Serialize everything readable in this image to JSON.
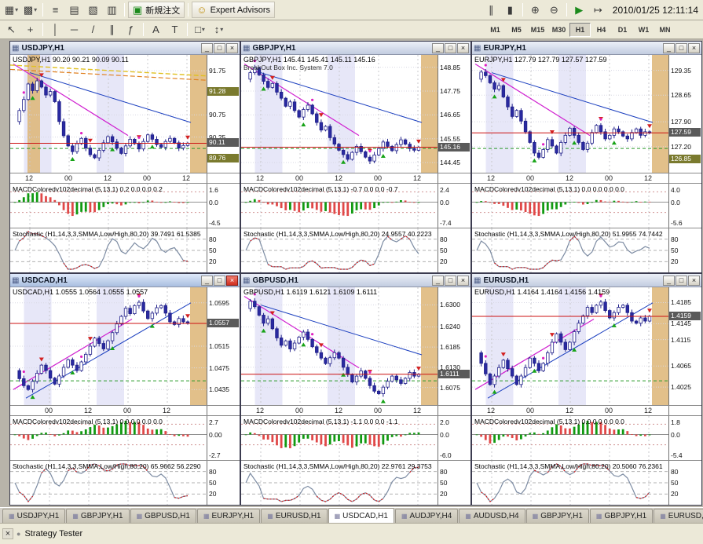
{
  "header": {
    "time": "2010/01/25 12:11:14",
    "new_order_label": "新規注文",
    "expert_advisors_label": "Expert Advisors"
  },
  "icons": {
    "dropdown": "▾",
    "new_chart": "▦",
    "profiles": "▩",
    "market_watch": "≡",
    "data_window": "▤",
    "navigator": "▧",
    "terminal": "▥",
    "new_order": "▣",
    "expert_advisors": "☺",
    "bar_chart": "∥",
    "candlestick": "▮",
    "line_chart": "~",
    "zoom_in": "⊕",
    "zoom_out": "⊖",
    "auto_scroll": "▶",
    "chart_shift": "↦",
    "cursor": "↖",
    "crosshair": "+",
    "vline": "│",
    "hline": "─",
    "trendline": "/",
    "channel": "∥",
    "fibonacci": "ƒ",
    "text": "A",
    "text_label": "T",
    "shapes": "□",
    "arrows": "↕",
    "tab_chart": "▦",
    "win_min": "_",
    "win_restore": "□",
    "win_close": "×",
    "close": "×",
    "bullet": "●"
  },
  "toolbar": {
    "timeframes": [
      "M1",
      "M5",
      "M15",
      "M30",
      "H1",
      "H4",
      "D1",
      "W1",
      "MN"
    ],
    "active_timeframe": "H1"
  },
  "colors": {
    "badge_current": "#5a5a5a",
    "badge_level": "#7a7a2e",
    "bull": "#ffffff",
    "bear": "#2a2aa0",
    "macd_up": "#119a11",
    "macd_down": "#e04848"
  },
  "charts": [
    {
      "title": "USDJPY,H1",
      "info": "USDJPY,H1 90.20 90.21 90.09 90.11",
      "info2": "",
      "active": false,
      "price_min": 89.55,
      "price_max": 92.0,
      "ticks": [
        "91.75",
        "90.75",
        "90.25"
      ],
      "badges": [
        {
          "label": "91.28",
          "color": "#7a7a2e"
        },
        {
          "label": "90.11",
          "color": "#5a5a5a"
        },
        {
          "label": "89.76",
          "color": "#7a7a2e"
        }
      ],
      "x_labels": [
        "12",
        "00",
        "12",
        "00",
        "12"
      ],
      "macd_label": "MACDColoredv102decimal (5,13,1) 0.2 0.0 0.0 0.2",
      "macd_ticks": [
        "1.6",
        "0.0",
        "-4.5"
      ],
      "stoch_label": "Stochastic (H1,14,3,3,SMMA,Low/High,80,20) 39.7491 61.5385",
      "stoch_ticks": [
        "80",
        "50",
        "20"
      ],
      "closes": [
        90.6,
        90.85,
        91.1,
        91.45,
        91.3,
        91.52,
        91.38,
        91.2,
        91.28,
        91.05,
        90.6,
        90.28,
        90.05,
        89.92,
        90.1,
        90.22,
        90.0,
        89.85,
        89.78,
        89.95,
        90.12,
        90.26,
        90.14,
        90.0,
        89.88,
        90.05,
        90.2,
        90.1,
        89.98,
        90.15,
        90.3,
        90.2,
        90.08,
        90.02,
        90.15,
        90.22,
        90.12,
        90.0,
        90.06,
        90.11
      ]
    },
    {
      "title": "GBPJPY,H1",
      "info": "GBPJPY,H1 145.41 145.41 145.11 145.16",
      "info2": "BreakOut Box Inc. System 7.0",
      "active": false,
      "price_min": 144.2,
      "price_max": 149.2,
      "ticks": [
        "148.85",
        "147.75",
        "146.65",
        "145.55",
        "144.45"
      ],
      "badges": [
        {
          "label": "145.16",
          "color": "#5a5a5a"
        }
      ],
      "x_labels": [
        "12",
        "00",
        "12",
        "00",
        "12"
      ],
      "macd_label": "MACDColoredv102decimal (5,13,1) -0.7 0.0 0.0 -0.7",
      "macd_ticks": [
        "2.4",
        "0.0",
        "-7.4"
      ],
      "stoch_label": "Stochastic (H1,14,3,3,SMMA,Low/High,80,20) 24.9557 40.2223",
      "stoch_ticks": [
        "80",
        "50",
        "20"
      ],
      "closes": [
        148.3,
        148.6,
        148.82,
        148.5,
        148.2,
        147.92,
        148.1,
        147.7,
        147.42,
        147.05,
        147.25,
        146.85,
        146.55,
        146.9,
        147.1,
        146.7,
        146.3,
        145.95,
        146.12,
        145.6,
        145.3,
        145.02,
        144.82,
        144.6,
        144.92,
        145.2,
        144.95,
        144.7,
        144.52,
        144.8,
        145.1,
        145.4,
        145.2,
        145.0,
        145.28,
        145.5,
        145.3,
        145.1,
        145.02,
        145.16
      ]
    },
    {
      "title": "EURJPY,H1",
      "info": "EURJPY,H1 127.79 127.79 127.57 127.59",
      "info2": "",
      "active": false,
      "price_min": 126.6,
      "price_max": 129.65,
      "ticks": [
        "129.35",
        "128.65",
        "127.90",
        "127.20"
      ],
      "badges": [
        {
          "label": "127.59",
          "color": "#5a5a5a"
        },
        {
          "label": "126.85",
          "color": "#7a7a2e"
        }
      ],
      "x_labels": [
        "12",
        "00",
        "12",
        "00",
        "12"
      ],
      "macd_label": "MACDColoredv102decimal (5,13,1) 0.0 0.0 0.0 0.0",
      "macd_ticks": [
        "4.0",
        "0.0",
        "-5.6"
      ],
      "stoch_label": "Stochastic (H1,14,3,3,SMMA,Low/High,80,20) 51.9955 74.7442",
      "stoch_ticks": [
        "80",
        "50",
        "20"
      ],
      "closes": [
        129.1,
        129.3,
        129.2,
        129.0,
        128.82,
        128.92,
        128.6,
        128.32,
        128.05,
        128.22,
        127.92,
        127.62,
        127.32,
        127.02,
        126.9,
        127.12,
        127.4,
        127.22,
        127.02,
        127.32,
        127.52,
        127.72,
        127.52,
        127.32,
        127.12,
        127.3,
        127.6,
        127.8,
        127.62,
        127.42,
        127.52,
        127.7,
        127.62,
        127.5,
        127.42,
        127.6,
        127.7,
        127.52,
        127.62,
        127.59
      ]
    },
    {
      "title": "USDCAD,H1",
      "info": "USDCAD,H1 1.0555 1.0564 1.0555 1.0557",
      "info2": "",
      "active": true,
      "price_min": 1.0415,
      "price_max": 1.0615,
      "ticks": [
        "1.0595",
        "1.0515",
        "1.0475",
        "1.0435"
      ],
      "badges": [
        {
          "label": "1.0557",
          "color": "#5a5a5a"
        }
      ],
      "x_labels": [
        "00",
        "12",
        "00",
        "12"
      ],
      "macd_label": "MACDColoredv102decimal (5,13,1) 0.0 0.0 0.0 0.0",
      "macd_ticks": [
        "2.7",
        "0.00",
        "-2.7"
      ],
      "stoch_label": "Stochastic (H1,14,3,3,SMMA,Low/High,80,20) 65.9662 56.2290",
      "stoch_ticks": [
        "80",
        "50",
        "20"
      ],
      "closes": [
        1.047,
        1.0455,
        1.0442,
        1.0435,
        1.045,
        1.0465,
        1.048,
        1.047,
        1.0456,
        1.0445,
        1.046,
        1.0476,
        1.049,
        1.048,
        1.047,
        1.0486,
        1.05,
        1.0515,
        1.053,
        1.052,
        1.051,
        1.0525,
        1.054,
        1.0556,
        1.057,
        1.0585,
        1.0575,
        1.059,
        1.0596,
        1.058,
        1.0566,
        1.0576,
        1.0586,
        1.059,
        1.0576,
        1.056,
        1.0555,
        1.0566,
        1.056,
        1.0557
      ]
    },
    {
      "title": "GBPUSD,H1",
      "info": "GBPUSD,H1 1.6119 1.6121 1.6109 1.6111",
      "info2": "",
      "active": false,
      "price_min": 1.604,
      "price_max": 1.6335,
      "ticks": [
        "1.6300",
        "1.6240",
        "1.6185",
        "1.6130",
        "1.6075"
      ],
      "badges": [
        {
          "label": "1.6111",
          "color": "#5a5a5a"
        }
      ],
      "x_labels": [
        "12",
        "00",
        "12",
        "00",
        "12"
      ],
      "macd_label": "MACDColoredv102decimal (5,13,1) -1.1 0.0 0.0 -1.1",
      "macd_ticks": [
        "2.0",
        "0.0",
        "-6.0"
      ],
      "stoch_label": "Stochastic (H1,14,3,3,SMMA,Low/High,80,20) 22.9761 29.3753",
      "stoch_ticks": [
        "80",
        "50",
        "20"
      ],
      "closes": [
        1.629,
        1.631,
        1.6295,
        1.6272,
        1.625,
        1.6262,
        1.6235,
        1.621,
        1.619,
        1.6202,
        1.618,
        1.6196,
        1.6212,
        1.6226,
        1.6206,
        1.6186,
        1.617,
        1.6155,
        1.614,
        1.6156,
        1.617,
        1.6155,
        1.613,
        1.611,
        1.609,
        1.6106,
        1.612,
        1.61,
        1.608,
        1.6065,
        1.6058,
        1.6076,
        1.6092,
        1.6106,
        1.6096,
        1.6086,
        1.61,
        1.6116,
        1.6106,
        1.6111
      ]
    },
    {
      "title": "EURUSD,H1",
      "info": "EURUSD,H1 1.4164 1.4164 1.4156 1.4159",
      "info2": "",
      "active": false,
      "price_min": 1.4,
      "price_max": 1.4205,
      "ticks": [
        "1.4185",
        "1.4145",
        "1.4115",
        "1.4065",
        "1.4025"
      ],
      "badges": [
        {
          "label": "1.4159",
          "color": "#5a5a5a"
        }
      ],
      "x_labels": [
        "12",
        "00",
        "12",
        "00",
        "12"
      ],
      "macd_label": "MACDColoredv102decimal (5,13,1) 0.0 0.0 0.0 0.0",
      "macd_ticks": [
        "1.8",
        "0.0",
        "-5.4"
      ],
      "stoch_label": "Stochastic (H1,14,3,3,SMMA,Low/High,80,20) 20.5060 76.2361",
      "stoch_ticks": [
        "80",
        "50",
        "20"
      ],
      "closes": [
        1.409,
        1.407,
        1.405,
        1.403,
        1.4046,
        1.4062,
        1.4076,
        1.406,
        1.4046,
        1.403,
        1.4046,
        1.4062,
        1.408,
        1.407,
        1.4056,
        1.407,
        1.409,
        1.411,
        1.4126,
        1.411,
        1.4096,
        1.411,
        1.413,
        1.4146,
        1.416,
        1.4176,
        1.4166,
        1.418,
        1.4186,
        1.417,
        1.4156,
        1.4166,
        1.4176,
        1.418,
        1.4166,
        1.415,
        1.4146,
        1.4156,
        1.415,
        1.4159
      ]
    }
  ],
  "tabbar": {
    "tabs": [
      "USDJPY,H1",
      "GBPJPY,H1",
      "GBPUSD,H1",
      "EURJPY,H1",
      "EURUSD,H1",
      "USDCAD,H1",
      "AUDJPY,H4",
      "AUDUSD,H4",
      "GBPJPY,H1",
      "GBPJPY,H1",
      "EURUSD,Daily"
    ],
    "active_index": 5
  },
  "statusbar": {
    "text": "Strategy Tester"
  }
}
